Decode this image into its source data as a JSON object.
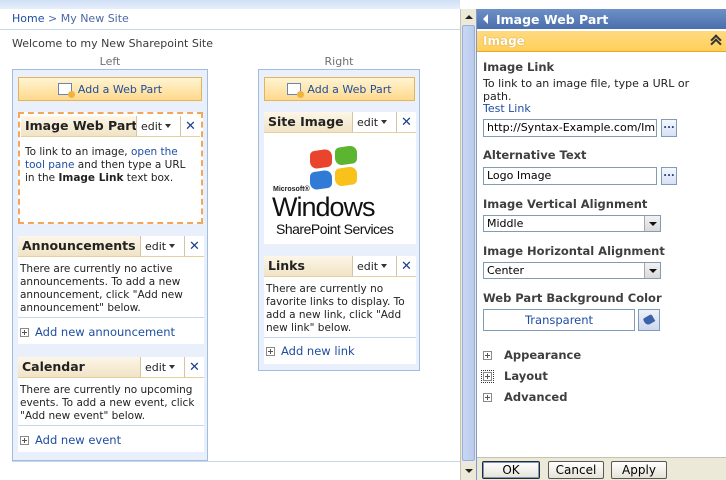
{
  "breadcrumb": {
    "home": "Home",
    "separator": ">",
    "current": "My New Site"
  },
  "welcome_text": "Welcome to my New Sharepoint Site",
  "left_zone": {
    "label": "Left",
    "add_web_part": "Add a Web Part",
    "image_web_part": {
      "title": "Image Web Part",
      "edit": "edit",
      "body_part1": "To link to an image, ",
      "body_link": "open the tool pane",
      "body_part2": " and then type a URL in the ",
      "body_bold": "Image Link",
      "body_part3": " text box."
    },
    "announcements": {
      "title": "Announcements",
      "edit": "edit",
      "body": "There are currently no active announcements. To add a new announcement, click \"Add new announcement\" below.",
      "footer_link": "Add new announcement"
    },
    "calendar": {
      "title": "Calendar",
      "edit": "edit",
      "body": "There are currently no upcoming events. To add a new event, click \"Add new event\" below.",
      "footer_link": "Add new event"
    }
  },
  "right_zone": {
    "label": "Right",
    "add_web_part": "Add a Web Part",
    "site_image": {
      "title": "Site Image",
      "edit": "edit",
      "logo_small": "Microsoft®",
      "logo_windows": "Windows",
      "logo_product": "SharePoint Services"
    },
    "links": {
      "title": "Links",
      "edit": "edit",
      "body": "There are currently no favorite links to display. To add a new link, click \"Add new link\" below.",
      "footer_link": "Add new link"
    }
  },
  "close_glyph": "✕",
  "tool_pane": {
    "title": "Image Web Part",
    "section": "Image",
    "image_link": {
      "label": "Image Link",
      "description": "To link to an image file, type a URL or path.",
      "test_link": "Test Link",
      "value": "http://Syntax-Example.com/Im",
      "builder": "..."
    },
    "alt_text": {
      "label": "Alternative Text",
      "value": "Logo Image",
      "builder": "..."
    },
    "vertical_alignment": {
      "label": "Image Vertical Alignment",
      "selected": "Middle"
    },
    "horizontal_alignment": {
      "label": "Image Horizontal Alignment",
      "selected": "Center"
    },
    "background_color": {
      "label": "Web Part Background Color",
      "value": "Transparent"
    },
    "categories": [
      "Appearance",
      "Layout",
      "Advanced"
    ],
    "buttons": {
      "ok": "OK",
      "cancel": "Cancel",
      "apply": "Apply"
    }
  },
  "colors": {
    "link": "#1f4ea0",
    "tool_pane_header": "#4b6fab",
    "section_header": "#ffcf5b",
    "zone_background": "#e9f0fb",
    "zone_border": "#9fbde0",
    "selected_part_border": "#f3a75a",
    "logo_red": "#e8452c",
    "logo_green": "#5bb531",
    "logo_blue": "#2f7bd6",
    "logo_yellow": "#f8c21a"
  },
  "icons": {
    "add_web_part": "add-web-part-icon",
    "close": "close-icon",
    "edit_menu": "chevron-down-icon",
    "back": "back-arrow-icon",
    "collapse": "double-chevron-up-icon",
    "expand": "plus-box-icon",
    "color_picker": "paint-bucket-icon"
  }
}
